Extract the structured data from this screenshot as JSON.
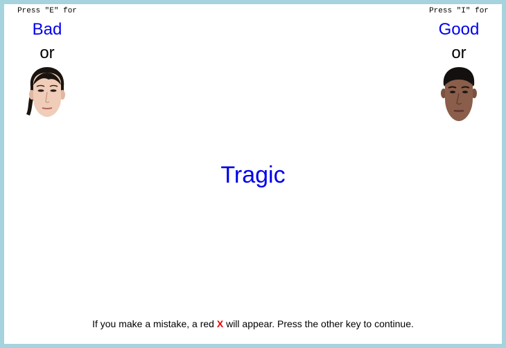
{
  "left_panel": {
    "press_text": "Press \"E\" for",
    "category": "Bad",
    "or_text": "or",
    "face_icon": "female-face-icon"
  },
  "right_panel": {
    "press_text": "Press \"I\" for",
    "category": "Good",
    "or_text": "or",
    "face_icon": "male-face-icon"
  },
  "stimulus": {
    "word": "Tragic"
  },
  "instructions": {
    "before": "If you make a mistake, a red ",
    "mark": "X",
    "after": " will appear. Press the other key to continue."
  },
  "colors": {
    "border": "#a5d3de",
    "category_text": "#0000ee",
    "error_mark": "#ee0000"
  }
}
